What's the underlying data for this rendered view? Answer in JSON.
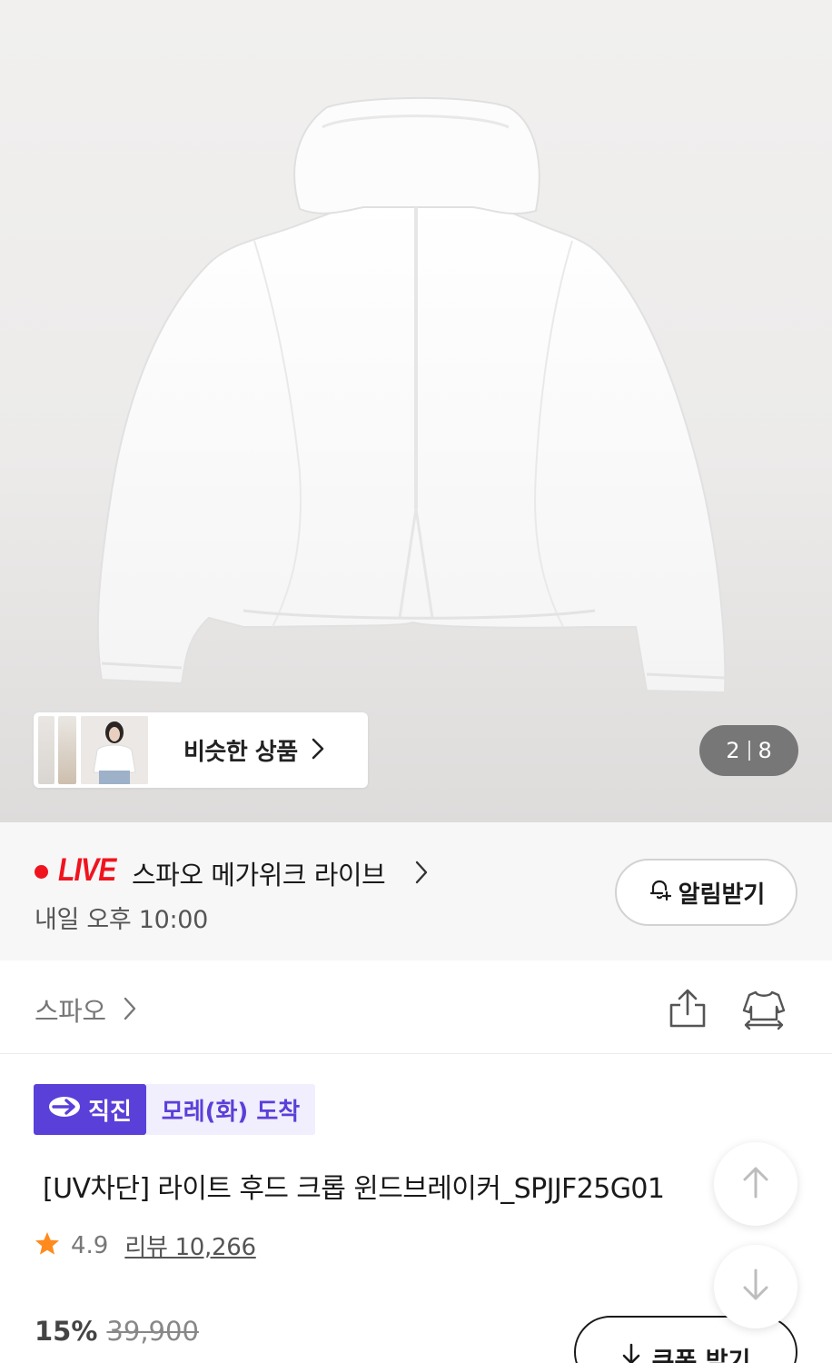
{
  "gallery": {
    "similar_label": "비슷한 상품",
    "current_index": "2",
    "total_images": "8"
  },
  "live": {
    "badge": "LIVE",
    "title": "스파오 메가위크 라이브",
    "time": "내일 오후 10:00",
    "alarm_label": "알림받기",
    "accent_color": "#f0141e"
  },
  "brand": {
    "name": "스파오"
  },
  "product": {
    "tag_direct": "직진",
    "tag_arrival": "모레(화) 도착",
    "tag_color": "#5b3fd9",
    "title": "[UV차단] 라이트 후드 크롭 윈드브레이커_SPJJF25G01",
    "rating": "4.9",
    "review_label": "리뷰 10,266",
    "discount": "15%",
    "original_price": "39,900",
    "coupon_label": "쿠폰 받기"
  },
  "icons": [
    "chevron-right-icon",
    "bell-plus-icon",
    "share-icon",
    "fit-size-icon",
    "star-icon",
    "arrow-up-icon",
    "arrow-down-icon",
    "download-arrow-icon",
    "direct-logo-icon"
  ]
}
